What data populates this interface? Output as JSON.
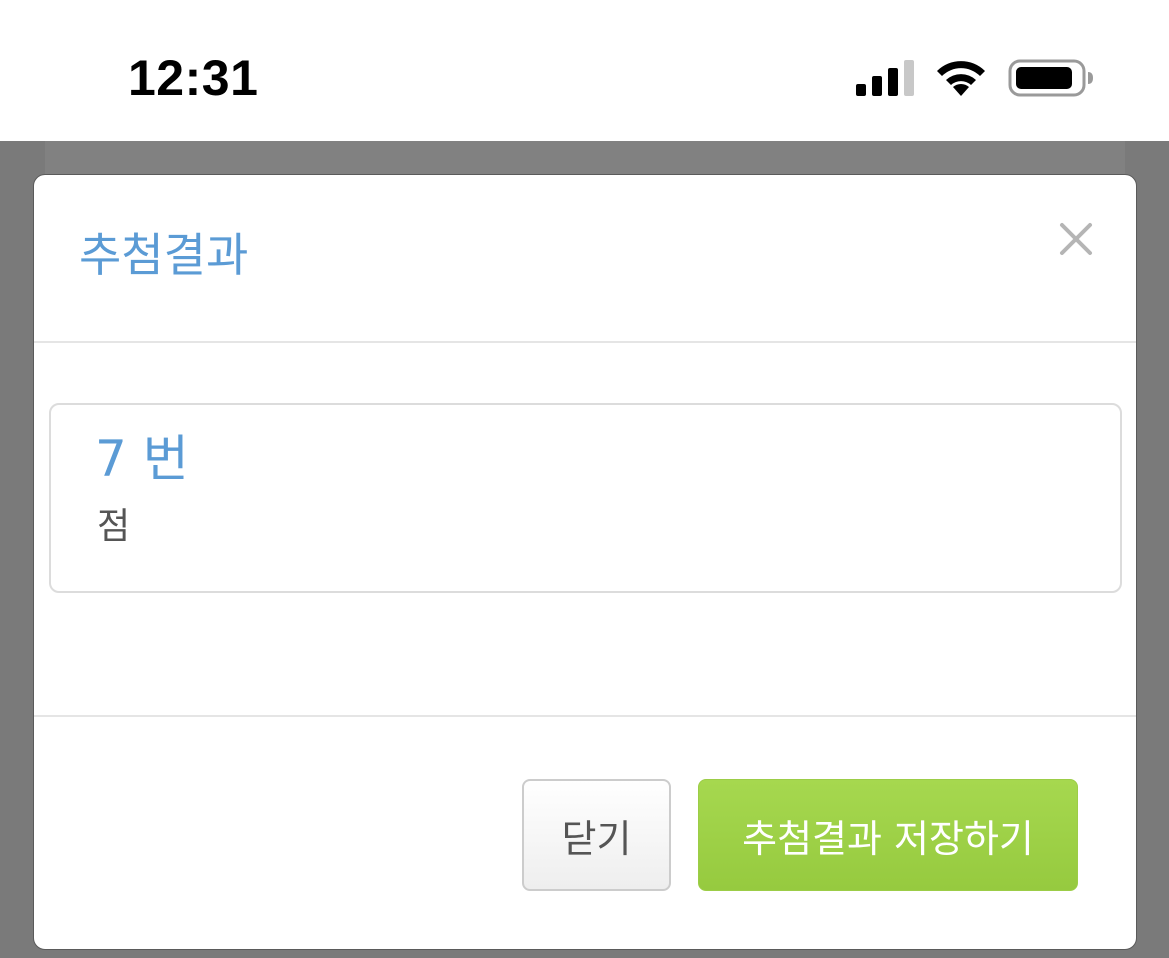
{
  "status_bar": {
    "time": "12:31",
    "signal": "signal-bars-icon",
    "wifi": "wifi-icon",
    "battery": "battery-icon"
  },
  "modal": {
    "title": "추첨결과",
    "close_icon": "close-icon",
    "result": {
      "number": "7 번",
      "subtext": "점"
    },
    "buttons": {
      "close_label": "닫기",
      "save_label": "추첨결과 저장하기"
    }
  },
  "colors": {
    "title_blue": "#5b9bd5",
    "save_green": "#a0d245",
    "backdrop": "#7a7a7a"
  }
}
